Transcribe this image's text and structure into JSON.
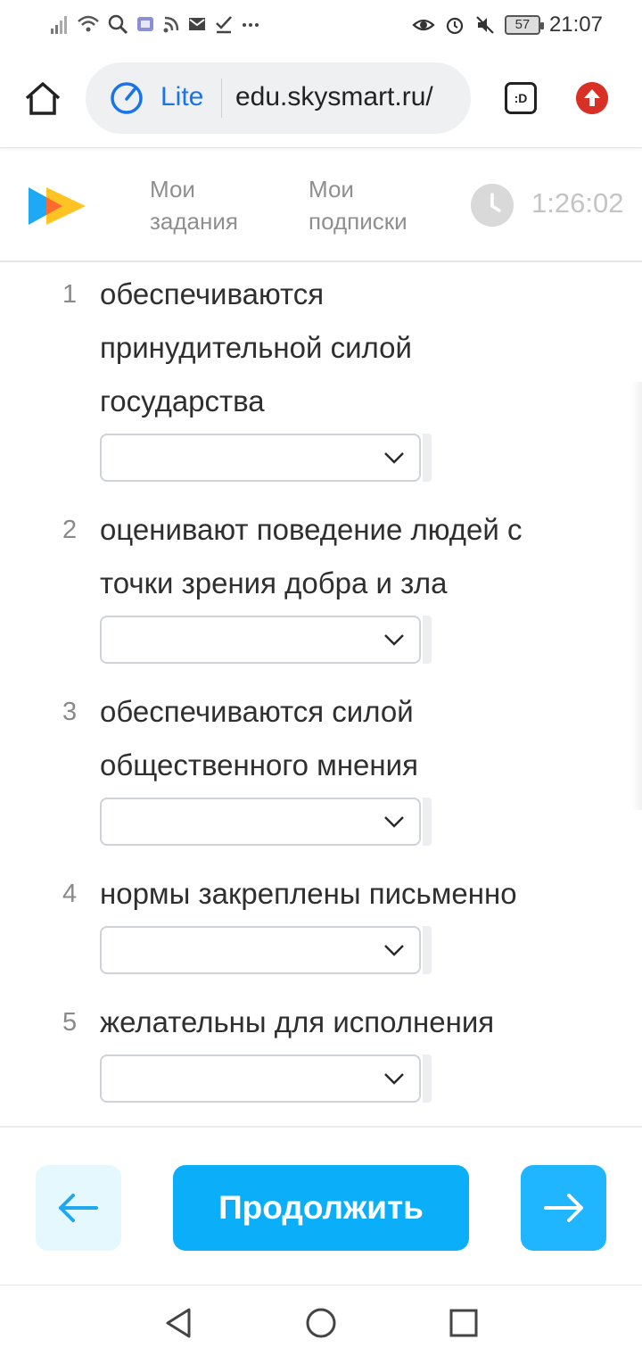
{
  "status_bar": {
    "time": "21:07",
    "battery": "57",
    "left_icons": [
      "signal-icon",
      "wifi-icon",
      "search-icon",
      "shield-app-icon",
      "rss-icon",
      "mail-icon",
      "check-icon",
      "more-dots-icon"
    ],
    "right_icons": [
      "eye-icon",
      "alarm-icon",
      "mute-icon",
      "battery-icon"
    ]
  },
  "browser": {
    "mode_label": "Lite",
    "url": "edu.skysmart.ru/",
    "tab_button_label": ":D",
    "accent_color": "#1a73e8"
  },
  "site_header": {
    "nav": [
      {
        "line1": "Мои",
        "line2": "задания"
      },
      {
        "line1": "Мои",
        "line2": "подписки"
      }
    ],
    "timer": "1:26:02"
  },
  "questions": [
    {
      "number": "1",
      "lines": [
        "обеспечиваются",
        "принудительной силой",
        "государства"
      ],
      "selected": ""
    },
    {
      "number": "2",
      "lines": [
        "оценивают поведение людей с",
        "точки зрения добра и зла"
      ],
      "selected": ""
    },
    {
      "number": "3",
      "lines": [
        "обеспечиваются силой",
        "общественного мнения"
      ],
      "selected": ""
    },
    {
      "number": "4",
      "lines": [
        "нормы закреплены письменно"
      ],
      "selected": ""
    },
    {
      "number": "5",
      "lines": [
        "желательны для исполнения"
      ],
      "selected": ""
    }
  ],
  "actions": {
    "continue_label": "Продолжить",
    "back_icon": "arrow-left-icon",
    "next_icon": "arrow-right-icon",
    "primary_color": "#0aaef9"
  },
  "system_nav": [
    "back-triangle-icon",
    "home-circle-icon",
    "recents-square-icon"
  ]
}
